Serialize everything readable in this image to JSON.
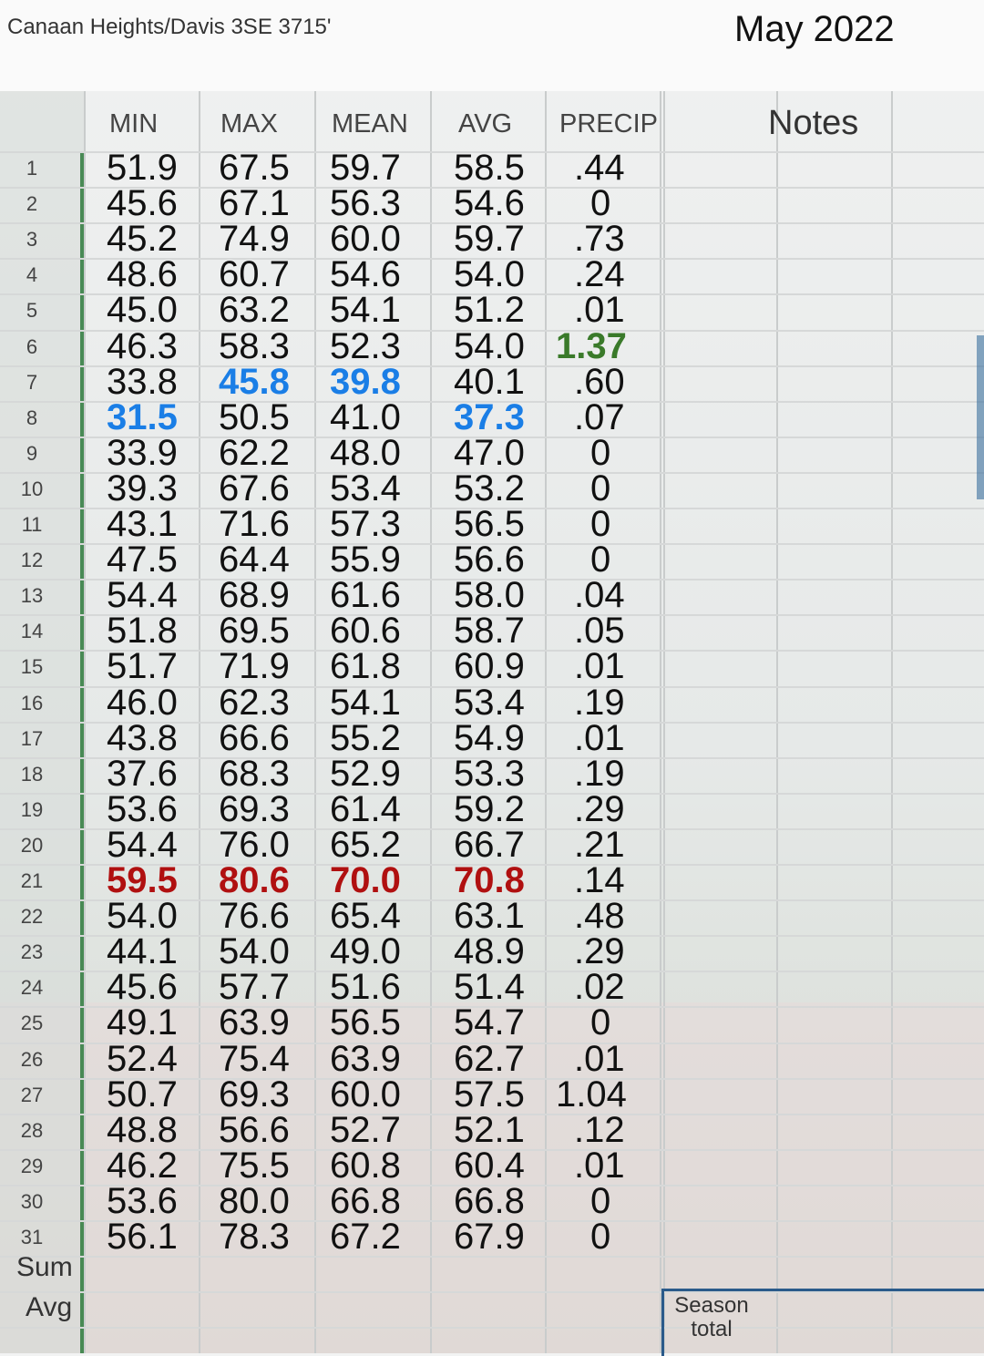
{
  "header": {
    "station": "Canaan Heights/Davis 3SE  3715'",
    "month": "May 2022"
  },
  "columns": [
    "MIN",
    "MAX",
    "MEAN",
    "AVG",
    "PRECIP"
  ],
  "notes_label": "Notes",
  "summary_labels": {
    "sum": "Sum",
    "avg": "Avg"
  },
  "season_total": "Season total",
  "colors": {
    "cold": "#1a7ee6",
    "hot": "#b01010",
    "wet": "#3a7a2a",
    "default": "#111111",
    "accent": "#2e7a3c"
  },
  "rows": [
    {
      "day": "1",
      "min": "51.9",
      "max": "67.5",
      "mean": "59.7",
      "avg": "58.5",
      "precip": ".44"
    },
    {
      "day": "2",
      "min": "45.6",
      "max": "67.1",
      "mean": "56.3",
      "avg": "54.6",
      "precip": "0"
    },
    {
      "day": "3",
      "min": "45.2",
      "max": "74.9",
      "mean": "60.0",
      "avg": "59.7",
      "precip": ".73"
    },
    {
      "day": "4",
      "min": "48.6",
      "max": "60.7",
      "mean": "54.6",
      "avg": "54.0",
      "precip": ".24"
    },
    {
      "day": "5",
      "min": "45.0",
      "max": "63.2",
      "mean": "54.1",
      "avg": "51.2",
      "precip": ".01"
    },
    {
      "day": "6",
      "min": "46.3",
      "max": "58.3",
      "mean": "52.3",
      "avg": "54.0",
      "precip": "1.37",
      "hi": {
        "precip": "wet"
      }
    },
    {
      "day": "7",
      "min": "33.8",
      "max": "45.8",
      "mean": "39.8",
      "avg": "40.1",
      "precip": ".60",
      "hi": {
        "max": "cold",
        "mean": "cold"
      }
    },
    {
      "day": "8",
      "min": "31.5",
      "max": "50.5",
      "mean": "41.0",
      "avg": "37.3",
      "precip": ".07",
      "hi": {
        "min": "cold",
        "avg": "cold"
      }
    },
    {
      "day": "9",
      "min": "33.9",
      "max": "62.2",
      "mean": "48.0",
      "avg": "47.0",
      "precip": "0"
    },
    {
      "day": "10",
      "min": "39.3",
      "max": "67.6",
      "mean": "53.4",
      "avg": "53.2",
      "precip": "0"
    },
    {
      "day": "11",
      "min": "43.1",
      "max": "71.6",
      "mean": "57.3",
      "avg": "56.5",
      "precip": "0"
    },
    {
      "day": "12",
      "min": "47.5",
      "max": "64.4",
      "mean": "55.9",
      "avg": "56.6",
      "precip": "0"
    },
    {
      "day": "13",
      "min": "54.4",
      "max": "68.9",
      "mean": "61.6",
      "avg": "58.0",
      "precip": ".04"
    },
    {
      "day": "14",
      "min": "51.8",
      "max": "69.5",
      "mean": "60.6",
      "avg": "58.7",
      "precip": ".05"
    },
    {
      "day": "15",
      "min": "51.7",
      "max": "71.9",
      "mean": "61.8",
      "avg": "60.9",
      "precip": ".01"
    },
    {
      "day": "16",
      "min": "46.0",
      "max": "62.3",
      "mean": "54.1",
      "avg": "53.4",
      "precip": ".19"
    },
    {
      "day": "17",
      "min": "43.8",
      "max": "66.6",
      "mean": "55.2",
      "avg": "54.9",
      "precip": ".01"
    },
    {
      "day": "18",
      "min": "37.6",
      "max": "68.3",
      "mean": "52.9",
      "avg": "53.3",
      "precip": ".19"
    },
    {
      "day": "19",
      "min": "53.6",
      "max": "69.3",
      "mean": "61.4",
      "avg": "59.2",
      "precip": ".29"
    },
    {
      "day": "20",
      "min": "54.4",
      "max": "76.0",
      "mean": "65.2",
      "avg": "66.7",
      "precip": ".21"
    },
    {
      "day": "21",
      "min": "59.5",
      "max": "80.6",
      "mean": "70.0",
      "avg": "70.8",
      "precip": ".14",
      "hi": {
        "min": "hot",
        "max": "hot",
        "mean": "hot",
        "avg": "hot"
      }
    },
    {
      "day": "22",
      "min": "54.0",
      "max": "76.6",
      "mean": "65.4",
      "avg": "63.1",
      "precip": ".48"
    },
    {
      "day": "23",
      "min": "44.1",
      "max": "54.0",
      "mean": "49.0",
      "avg": "48.9",
      "precip": ".29"
    },
    {
      "day": "24",
      "min": "45.6",
      "max": "57.7",
      "mean": "51.6",
      "avg": "51.4",
      "precip": ".02"
    },
    {
      "day": "25",
      "min": "49.1",
      "max": "63.9",
      "mean": "56.5",
      "avg": "54.7",
      "precip": "0"
    },
    {
      "day": "26",
      "min": "52.4",
      "max": "75.4",
      "mean": "63.9",
      "avg": "62.7",
      "precip": ".01"
    },
    {
      "day": "27",
      "min": "50.7",
      "max": "69.3",
      "mean": "60.0",
      "avg": "57.5",
      "precip": "1.04"
    },
    {
      "day": "28",
      "min": "48.8",
      "max": "56.6",
      "mean": "52.7",
      "avg": "52.1",
      "precip": ".12"
    },
    {
      "day": "29",
      "min": "46.2",
      "max": "75.5",
      "mean": "60.8",
      "avg": "60.4",
      "precip": ".01"
    },
    {
      "day": "30",
      "min": "53.6",
      "max": "80.0",
      "mean": "66.8",
      "avg": "66.8",
      "precip": "0"
    },
    {
      "day": "31",
      "min": "56.1",
      "max": "78.3",
      "mean": "67.2",
      "avg": "67.9",
      "precip": "0"
    }
  ]
}
